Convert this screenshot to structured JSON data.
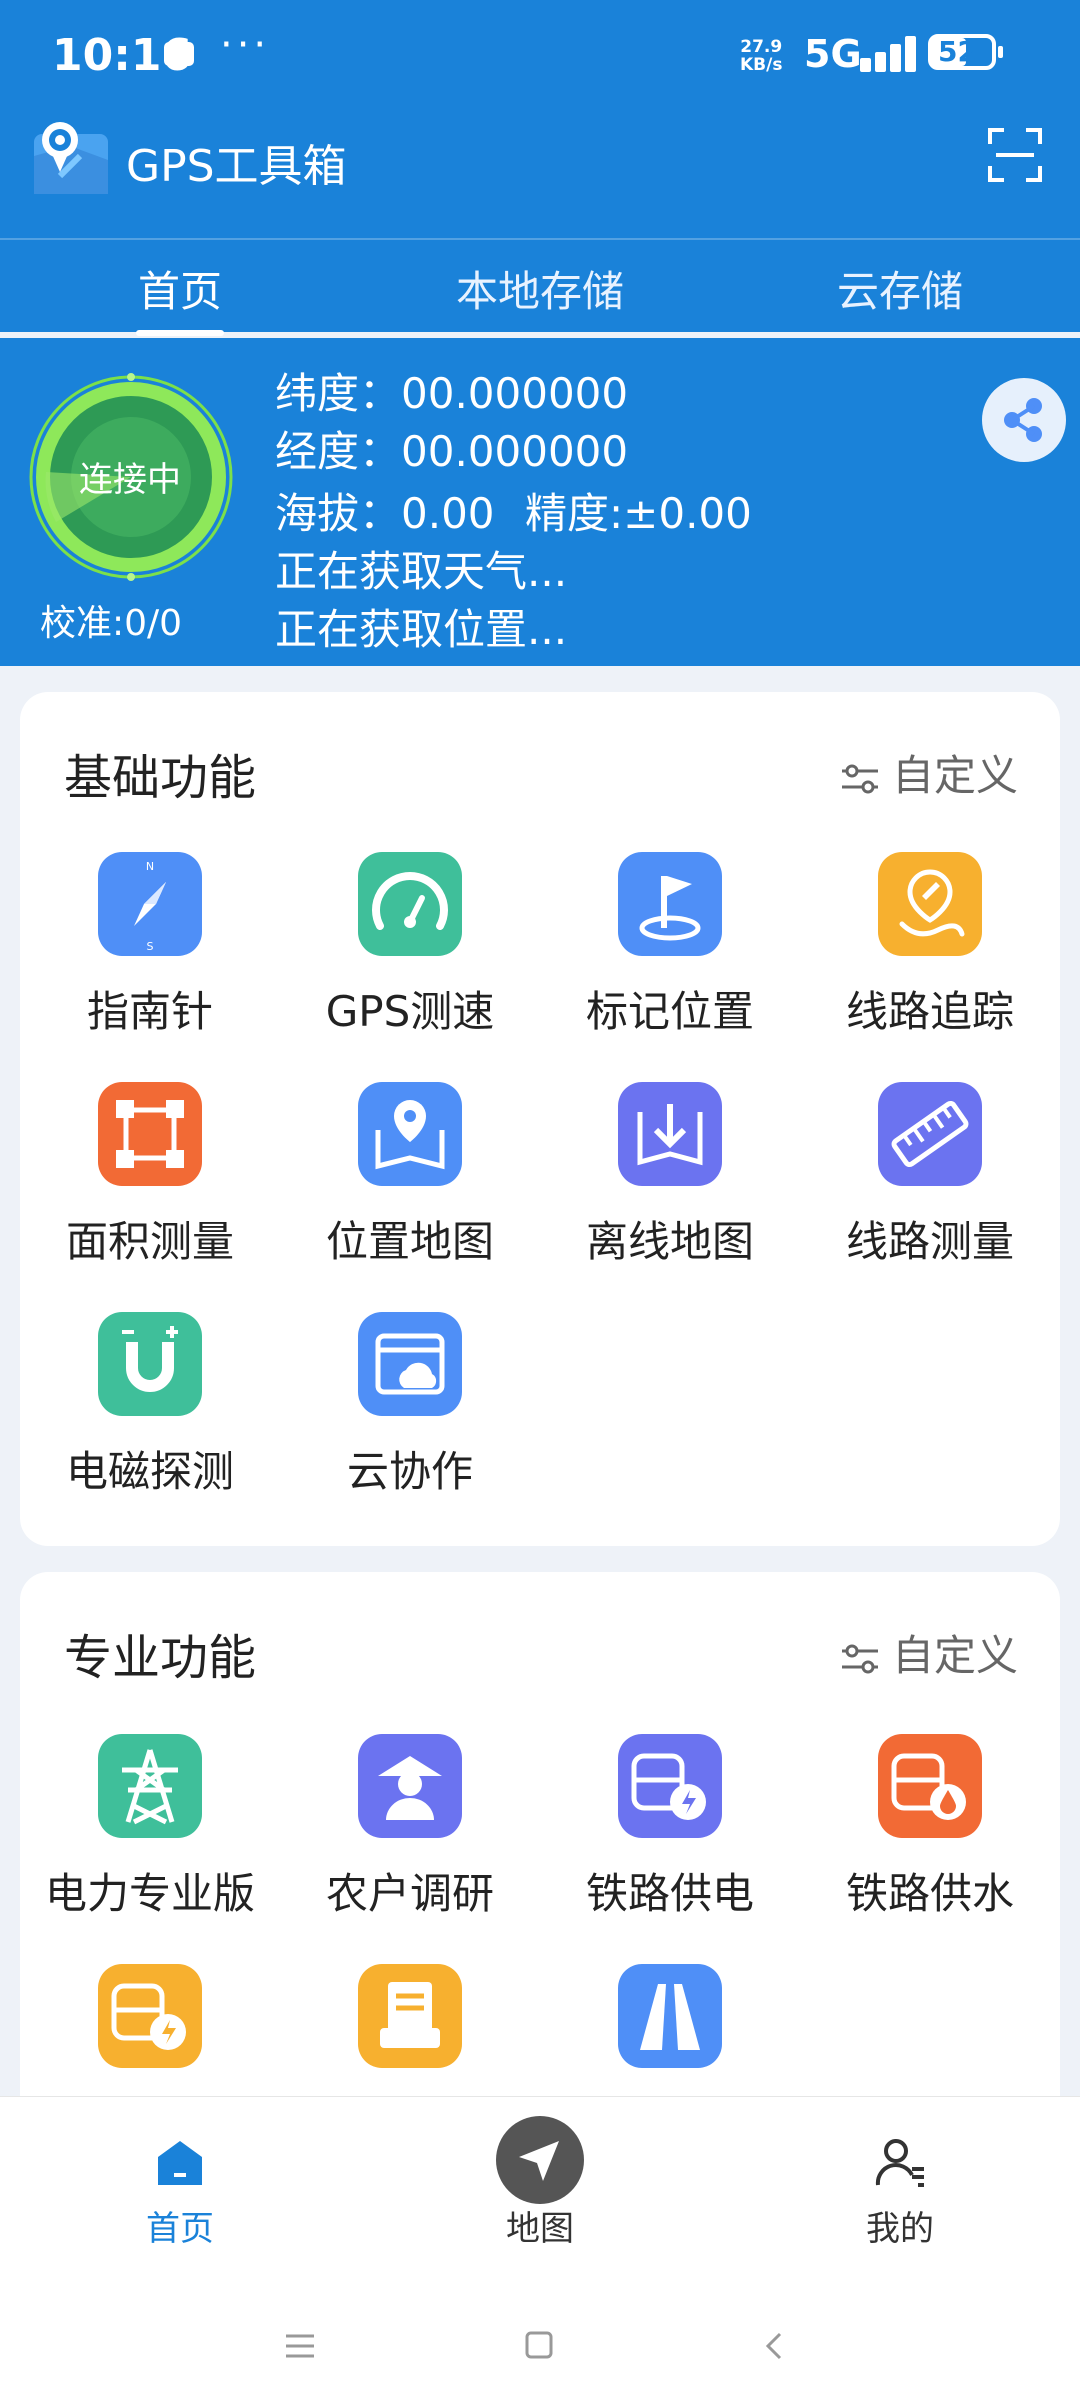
{
  "status_bar": {
    "time": "10:16",
    "dots": "···",
    "speed_value": "27.9",
    "speed_unit": "KB/s",
    "network": "5G",
    "battery": "52"
  },
  "app": {
    "title": "GPS工具箱"
  },
  "tabs": [
    {
      "label": "首页",
      "active": true
    },
    {
      "label": "本地存储",
      "active": false
    },
    {
      "label": "云存储",
      "active": false
    }
  ],
  "gps": {
    "status": "连接中",
    "calibration": "校准:0/0",
    "latitude": "纬度：00.000000",
    "longitude": "经度：00.000000",
    "altitude": "海拔：0.00",
    "accuracy": "精度:±0.00",
    "weather": "正在获取天气...",
    "location": "正在获取位置..."
  },
  "basic": {
    "title": "基础功能",
    "customize": "自定义",
    "items": [
      {
        "label": "指南针",
        "icon": "compass-icon",
        "color": "#4f8ff7"
      },
      {
        "label": "GPS测速",
        "icon": "speedometer-icon",
        "color": "#3fbf9a"
      },
      {
        "label": "标记位置",
        "icon": "flag-icon",
        "color": "#4f8ff7"
      },
      {
        "label": "线路追踪",
        "icon": "route-pin-icon",
        "color": "#f7b02f"
      },
      {
        "label": "面积测量",
        "icon": "area-icon",
        "color": "#f26a35"
      },
      {
        "label": "位置地图",
        "icon": "map-pin-icon",
        "color": "#4f8ff7"
      },
      {
        "label": "离线地图",
        "icon": "download-map-icon",
        "color": "#6b73f0"
      },
      {
        "label": "线路测量",
        "icon": "ruler-icon",
        "color": "#6b73f0"
      },
      {
        "label": "电磁探测",
        "icon": "magnet-icon",
        "color": "#3fbf9a"
      },
      {
        "label": "云协作",
        "icon": "cloud-folder-icon",
        "color": "#4f8ff7"
      }
    ]
  },
  "pro": {
    "title": "专业功能",
    "customize": "自定义",
    "items": [
      {
        "label": "电力专业版",
        "icon": "power-tower-icon",
        "color": "#3fbf9a"
      },
      {
        "label": "农户调研",
        "icon": "farmer-icon",
        "color": "#6b73f0"
      },
      {
        "label": "铁路供电",
        "icon": "train-power-icon",
        "color": "#6b73f0"
      },
      {
        "label": "铁路供水",
        "icon": "train-water-icon",
        "color": "#f26a35"
      },
      {
        "label": "",
        "icon": "train-bolt-icon",
        "color": "#f7b02f"
      },
      {
        "label": "",
        "icon": "document-icon",
        "color": "#f7b02f"
      },
      {
        "label": "",
        "icon": "road-icon",
        "color": "#4f8ff7"
      }
    ]
  },
  "bottom_nav": [
    {
      "label": "首页",
      "icon": "home-icon",
      "active": true
    },
    {
      "label": "地图",
      "icon": "navigate-icon",
      "active": false
    },
    {
      "label": "我的",
      "icon": "profile-icon",
      "active": false
    }
  ],
  "colors": {
    "primary": "#1a82d9",
    "nav_active": "#1a82d9"
  }
}
